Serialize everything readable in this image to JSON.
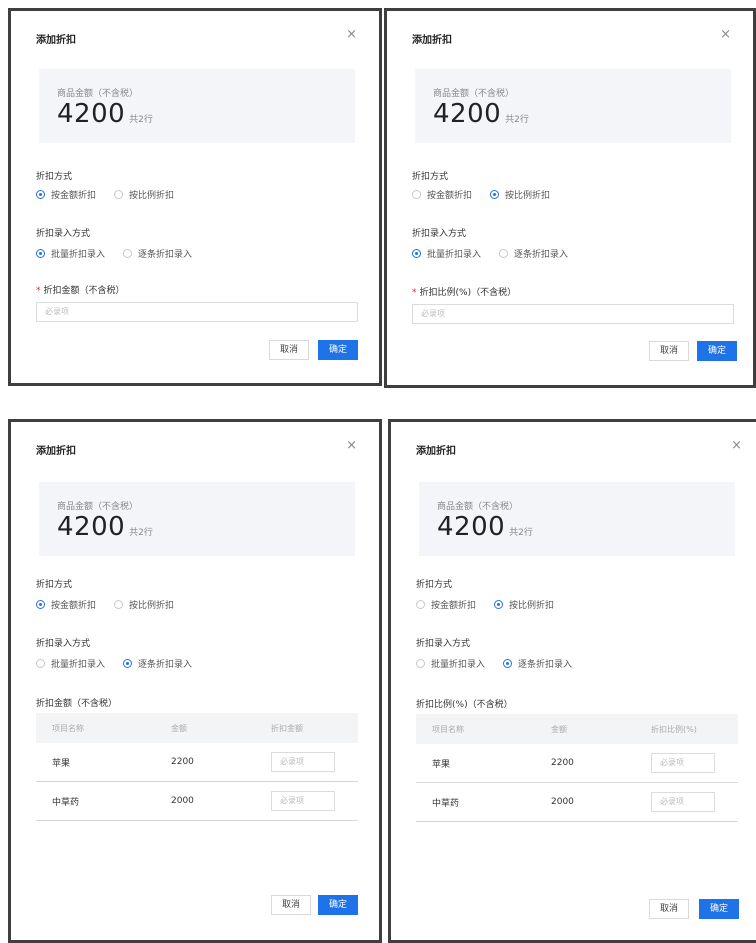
{
  "dialogs": [
    {
      "title": "添加折扣",
      "close": "×",
      "summary": {
        "label": "商品金额（不含税）",
        "amount": "4200",
        "rows": "共2行"
      },
      "method": {
        "label": "折扣方式",
        "options": [
          "按金额折扣",
          "按比例折扣"
        ],
        "selected": "按金额折扣"
      },
      "entry": {
        "label": "折扣录入方式",
        "options": [
          "批量折扣录入",
          "逐条折扣录入"
        ],
        "selected": "批量折扣录入"
      },
      "field": {
        "label": "折扣金额（不含税）",
        "placeholder": "必录项"
      },
      "cancel": "取消",
      "ok": "确定"
    },
    {
      "title": "添加折扣",
      "close": "×",
      "summary": {
        "label": "商品金额（不含税）",
        "amount": "4200",
        "rows": "共2行"
      },
      "method": {
        "label": "折扣方式",
        "options": [
          "按金额折扣",
          "按比例折扣"
        ],
        "selected": "按比例折扣"
      },
      "entry": {
        "label": "折扣录入方式",
        "options": [
          "批量折扣录入",
          "逐条折扣录入"
        ],
        "selected": "批量折扣录入"
      },
      "field": {
        "label": "折扣比例(%)（不含税）",
        "placeholder": "必录项"
      },
      "cancel": "取消",
      "ok": "确定"
    },
    {
      "title": "添加折扣",
      "close": "×",
      "summary": {
        "label": "商品金额（不含税）",
        "amount": "4200",
        "rows": "共2行"
      },
      "method": {
        "label": "折扣方式",
        "options": [
          "按金额折扣",
          "按比例折扣"
        ],
        "selected": "按金额折扣"
      },
      "entry": {
        "label": "折扣录入方式",
        "options": [
          "批量折扣录入",
          "逐条折扣录入"
        ],
        "selected": "逐条折扣录入"
      },
      "table": {
        "label": "折扣金额（不含税）",
        "headers": [
          "项目名称",
          "金额",
          "折扣金额"
        ],
        "rows": [
          {
            "name": "苹果",
            "amount": "2200",
            "placeholder": "必录项"
          },
          {
            "name": "中草药",
            "amount": "2000",
            "placeholder": "必录项"
          }
        ]
      },
      "cancel": "取消",
      "ok": "确定"
    },
    {
      "title": "添加折扣",
      "close": "×",
      "summary": {
        "label": "商品金额（不含税）",
        "amount": "4200",
        "rows": "共2行"
      },
      "method": {
        "label": "折扣方式",
        "options": [
          "按金额折扣",
          "按比例折扣"
        ],
        "selected": "按比例折扣"
      },
      "entry": {
        "label": "折扣录入方式",
        "options": [
          "批量折扣录入",
          "逐条折扣录入"
        ],
        "selected": "逐条折扣录入"
      },
      "table": {
        "label": "折扣比例(%)（不含税）",
        "headers": [
          "项目名称",
          "金额",
          "折扣比例(%)"
        ],
        "rows": [
          {
            "name": "苹果",
            "amount": "2200",
            "placeholder": "必录项"
          },
          {
            "name": "中草药",
            "amount": "2000",
            "placeholder": "必录项"
          }
        ]
      },
      "cancel": "取消",
      "ok": "确定"
    }
  ]
}
